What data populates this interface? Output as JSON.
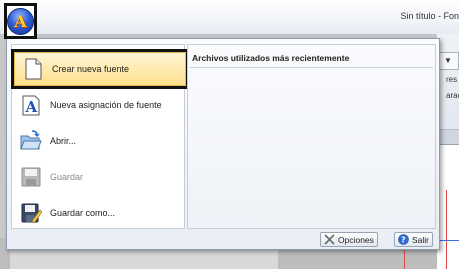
{
  "window": {
    "title": "Sin título - Fon"
  },
  "background": {
    "dropdown_glyph": "▼",
    "labels": [
      "res",
      "aract"
    ]
  },
  "app_button": {
    "icon": "app-orb-icon",
    "letter": "A"
  },
  "menu": {
    "items": [
      {
        "label": "Crear nueva fuente",
        "icon": "new-page-icon",
        "selected": true,
        "enabled": true
      },
      {
        "label": "Nueva asignación de fuente",
        "icon": "font-map-icon",
        "selected": false,
        "enabled": true
      },
      {
        "label": "Abrir...",
        "icon": "open-folder-icon",
        "selected": false,
        "enabled": true
      },
      {
        "label": "Guardar",
        "icon": "save-icon",
        "selected": false,
        "enabled": false
      },
      {
        "label": "Guardar como...",
        "icon": "save-as-icon",
        "selected": false,
        "enabled": true
      }
    ],
    "recent_header": "Archivos utilizados más recientemente",
    "footer": {
      "options_label": "Opciones",
      "exit_label": "Salir"
    }
  },
  "colors": {
    "selection_fill": "#ffe08a",
    "selection_border": "#111111",
    "accent_blue": "#2e5fd3"
  }
}
